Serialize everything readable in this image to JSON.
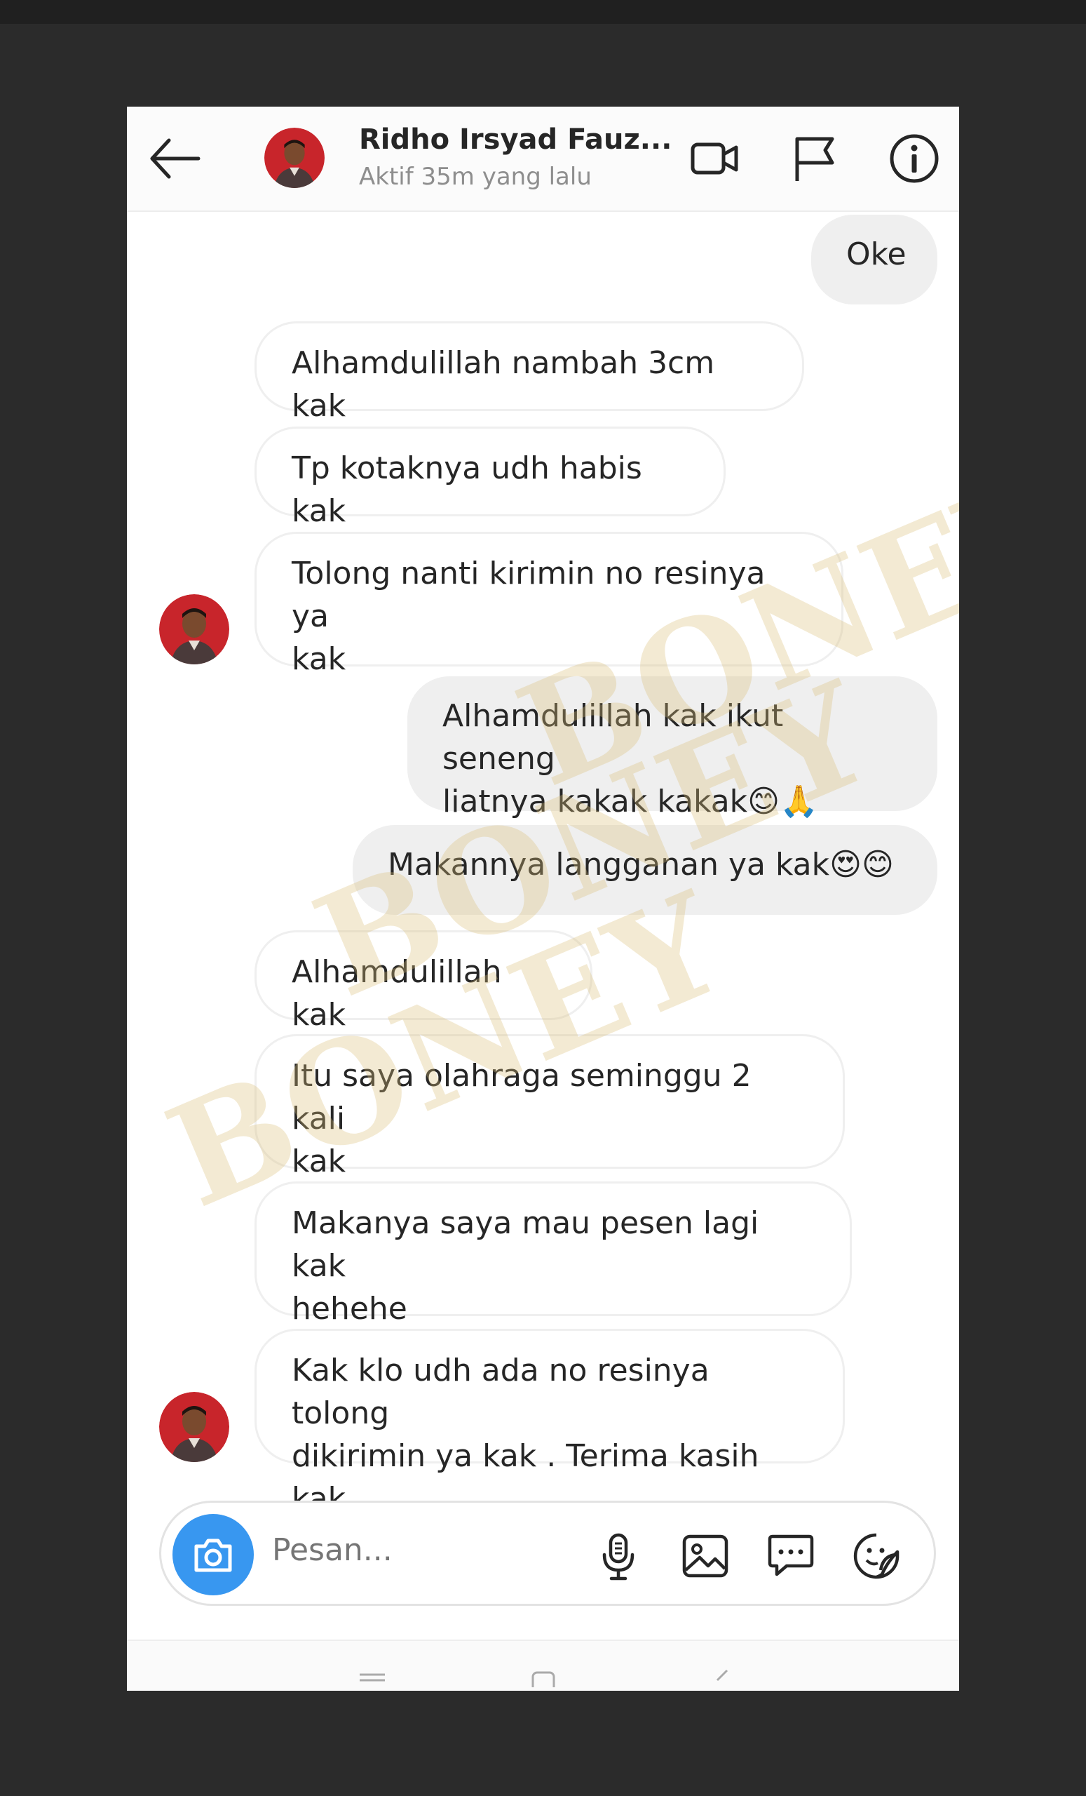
{
  "header": {
    "contact_name": "Ridho Irsyad Fauz...",
    "status": "Aktif 35m yang lalu",
    "back_icon": "arrow-left-icon",
    "video_icon": "video-camera-icon",
    "flag_icon": "flag-icon",
    "info_icon": "info-icon"
  },
  "messages": [
    {
      "side": "out",
      "text": "Oke"
    },
    {
      "side": "in",
      "text": "Alhamdulillah nambah 3cm kak"
    },
    {
      "side": "in",
      "text": "Tp kotaknya udh habis kak"
    },
    {
      "side": "in",
      "line1": "Tolong nanti kirimin no resinya ya",
      "line2": "kak"
    },
    {
      "side": "out",
      "line1": "Alhamdulillah kak ikut seneng",
      "line2": "liatnya kakak kakak😊🙏"
    },
    {
      "side": "out",
      "text": "Makannya langganan ya kak😍😊"
    },
    {
      "side": "in",
      "text": "Alhamdulillah kak"
    },
    {
      "side": "in",
      "line1": "Itu saya olahraga seminggu 2 kali",
      "line2": "kak"
    },
    {
      "side": "in",
      "line1": "Makanya saya mau pesen lagi kak",
      "line2": "hehehe"
    },
    {
      "side": "in",
      "line1": "Kak klo udh ada no resinya tolong",
      "line2": "dikirimin ya kak . Terima kasih kak"
    }
  ],
  "composer": {
    "placeholder": "Pesan...",
    "camera_icon": "camera-icon",
    "mic_icon": "microphone-icon",
    "gallery_icon": "image-icon",
    "chat_icon": "speech-bubble-icon",
    "sticker_icon": "sticker-icon"
  },
  "watermark": "BONEY",
  "colors": {
    "accent": "#3897f0",
    "outgoing_bubble": "#efefef",
    "avatar_red": "#c8252b"
  }
}
